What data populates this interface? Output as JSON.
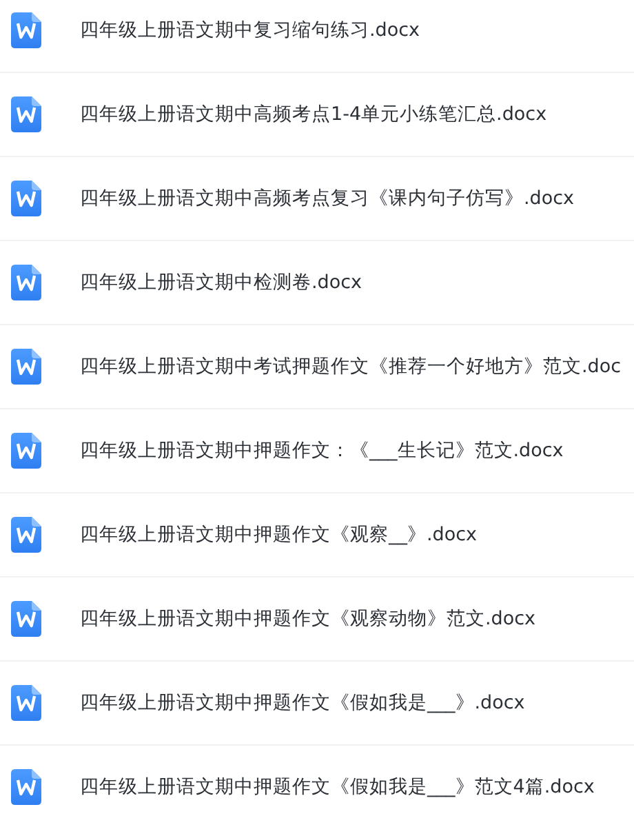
{
  "files": [
    {
      "name": "四年级上册语文期中复习缩句练习.docx"
    },
    {
      "name": "四年级上册语文期中高频考点1-4单元小练笔汇总.docx"
    },
    {
      "name": "四年级上册语文期中高频考点复习《课内句子仿写》.docx"
    },
    {
      "name": "四年级上册语文期中检测卷.docx"
    },
    {
      "name": "四年级上册语文期中考试押题作文《推荐一个好地方》范文.doc"
    },
    {
      "name": "四年级上册语文期中押题作文：《___生长记》范文.docx"
    },
    {
      "name": "四年级上册语文期中押题作文《观察__》.docx"
    },
    {
      "name": "四年级上册语文期中押题作文《观察动物》范文.docx"
    },
    {
      "name": "四年级上册语文期中押题作文《假如我是___》.docx"
    },
    {
      "name": "四年级上册语文期中押题作文《假如我是___》范文4篇.docx"
    }
  ]
}
